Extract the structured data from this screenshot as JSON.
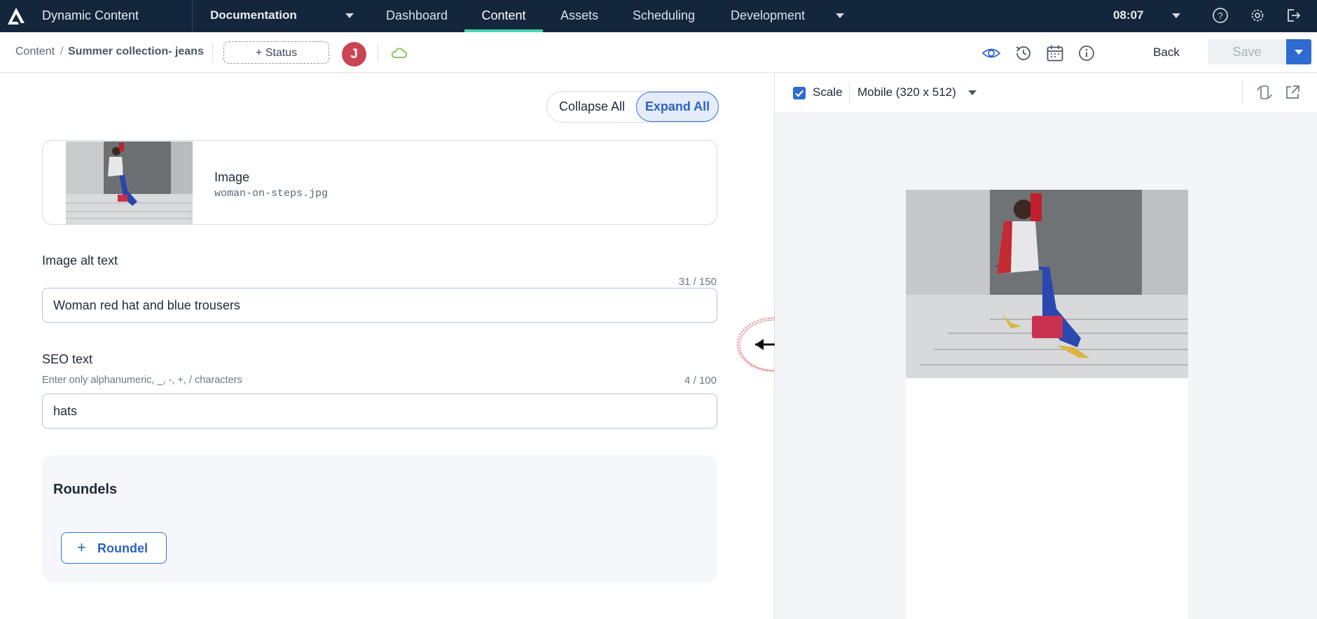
{
  "app": {
    "brand": "Dynamic Content",
    "hub": "Documentation",
    "tabs": [
      {
        "label": "Dashboard",
        "active": false
      },
      {
        "label": "Content",
        "active": true
      },
      {
        "label": "Assets",
        "active": false
      },
      {
        "label": "Scheduling",
        "active": false
      },
      {
        "label": "Development",
        "active": false
      }
    ],
    "clock": "08:07",
    "accent_color": "#4ad3b0",
    "nav_background": "#14263c"
  },
  "toolbar": {
    "breadcrumb": {
      "root": "Content",
      "separator": "/",
      "current": "Summer collection- jeans"
    },
    "status_button": "+ Status",
    "avatar_initial": "J",
    "avatar_color": "#c94553",
    "back_label": "Back",
    "save_label": "Save",
    "icons": [
      "cloud-icon",
      "eye-icon",
      "history-icon",
      "calendar-icon",
      "info-icon"
    ]
  },
  "form": {
    "collapse_label": "Collapse All",
    "expand_label": "Expand All",
    "image": {
      "title": "Image",
      "filename": "woman-on-steps.jpg"
    },
    "alt_text": {
      "label": "Image alt text",
      "counter": "31 / 150",
      "value": "Woman red hat and blue trousers"
    },
    "seo_text": {
      "label": "SEO text",
      "hint": "Enter only alphanumeric, _, -, +, / characters",
      "counter": "4 / 100",
      "value": "hats"
    },
    "roundels": {
      "title": "Roundels",
      "add_label": "Roundel"
    }
  },
  "preview": {
    "scale_label": "Scale",
    "scale_checked": true,
    "device": "Mobile (320 x 512)",
    "icons": [
      "rotate-device-icon",
      "open-external-icon"
    ]
  }
}
